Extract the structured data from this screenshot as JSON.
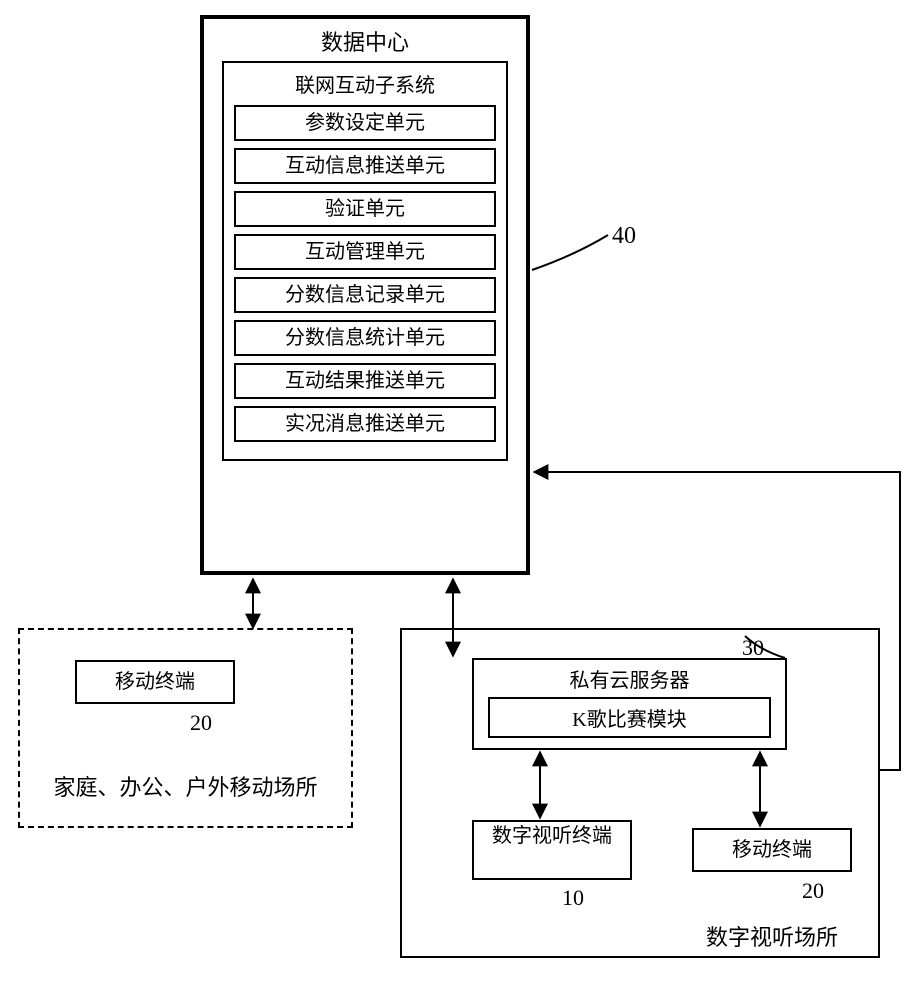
{
  "data_center": {
    "title": "数据中心",
    "subsystem_title": "联网互动子系统",
    "units": [
      "参数设定单元",
      "互动信息推送单元",
      "验证单元",
      "互动管理单元",
      "分数信息记录单元",
      "分数信息统计单元",
      "互动结果推送单元",
      "实况消息推送单元"
    ],
    "label": "40"
  },
  "home": {
    "mobile_terminal": "移动终端",
    "mobile_label": "20",
    "caption": "家庭、办公、户外移动场所"
  },
  "venue": {
    "server_title": "私有云服务器",
    "k_module": "K歌比赛模块",
    "server_label": "30",
    "av_terminal": "数字视听终端",
    "av_label": "10",
    "mobile_terminal": "移动终端",
    "mobile_label": "20",
    "caption": "数字视听场所"
  }
}
